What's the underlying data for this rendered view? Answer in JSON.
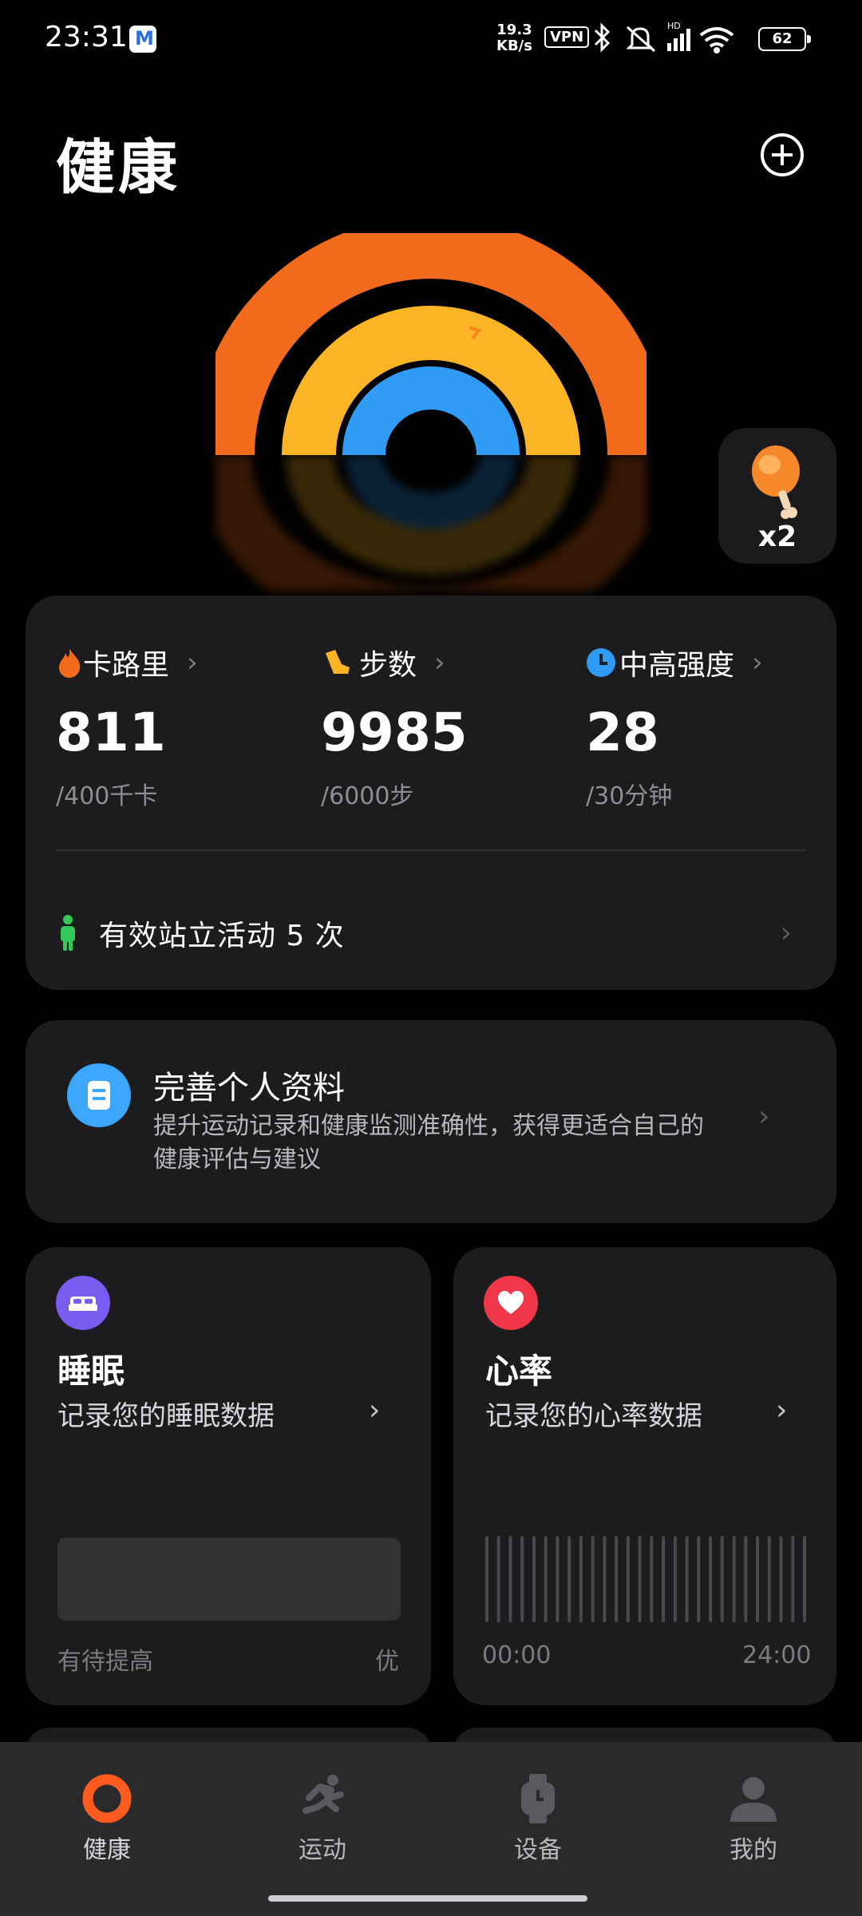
{
  "status_bar": {
    "time": "23:31",
    "net_speed_value": "19.3",
    "net_speed_unit": "KB/s",
    "vpn": "VPN",
    "battery": "62"
  },
  "header": {
    "title": "健康"
  },
  "achievement": {
    "count": "x2"
  },
  "activity": {
    "calories": {
      "label": "卡路里",
      "value": "811",
      "goal": "/400千卡"
    },
    "steps": {
      "label": "步数",
      "value": "9985",
      "goal": "/6000步"
    },
    "intensity": {
      "label": "中高强度",
      "value": "28",
      "goal": "/30分钟"
    },
    "stand": {
      "text": "有效站立活动 5 次"
    }
  },
  "profile": {
    "title": "完善个人资料",
    "desc_line1": "提升运动记录和健康监测准确性，获得更适合自己的",
    "desc_line2": "健康评估与建议"
  },
  "sleep": {
    "title": "睡眠",
    "desc": "记录您的睡眠数据",
    "scale_low": "有待提高",
    "scale_high": "优"
  },
  "heart_rate": {
    "title": "心率",
    "desc": "记录您的心率数据",
    "time_start": "00:00",
    "time_end": "24:00"
  },
  "bottom_nav": [
    {
      "label": "健康",
      "icon": "ring-icon",
      "active": true
    },
    {
      "label": "运动",
      "icon": "running-icon",
      "active": false
    },
    {
      "label": "设备",
      "icon": "watch-icon",
      "active": false
    },
    {
      "label": "我的",
      "icon": "profile-icon",
      "active": false
    }
  ],
  "colors": {
    "calories_ring": "#f26a1b",
    "steps_ring": "#fbb425",
    "intensity_ring": "#2f9bf5",
    "stand_icon": "#34c759",
    "sleep_icon": "#7a5cf0",
    "heart_icon": "#f0374a",
    "profile_icon": "#3ba7ff",
    "nav_active": "#ff5a1f"
  }
}
